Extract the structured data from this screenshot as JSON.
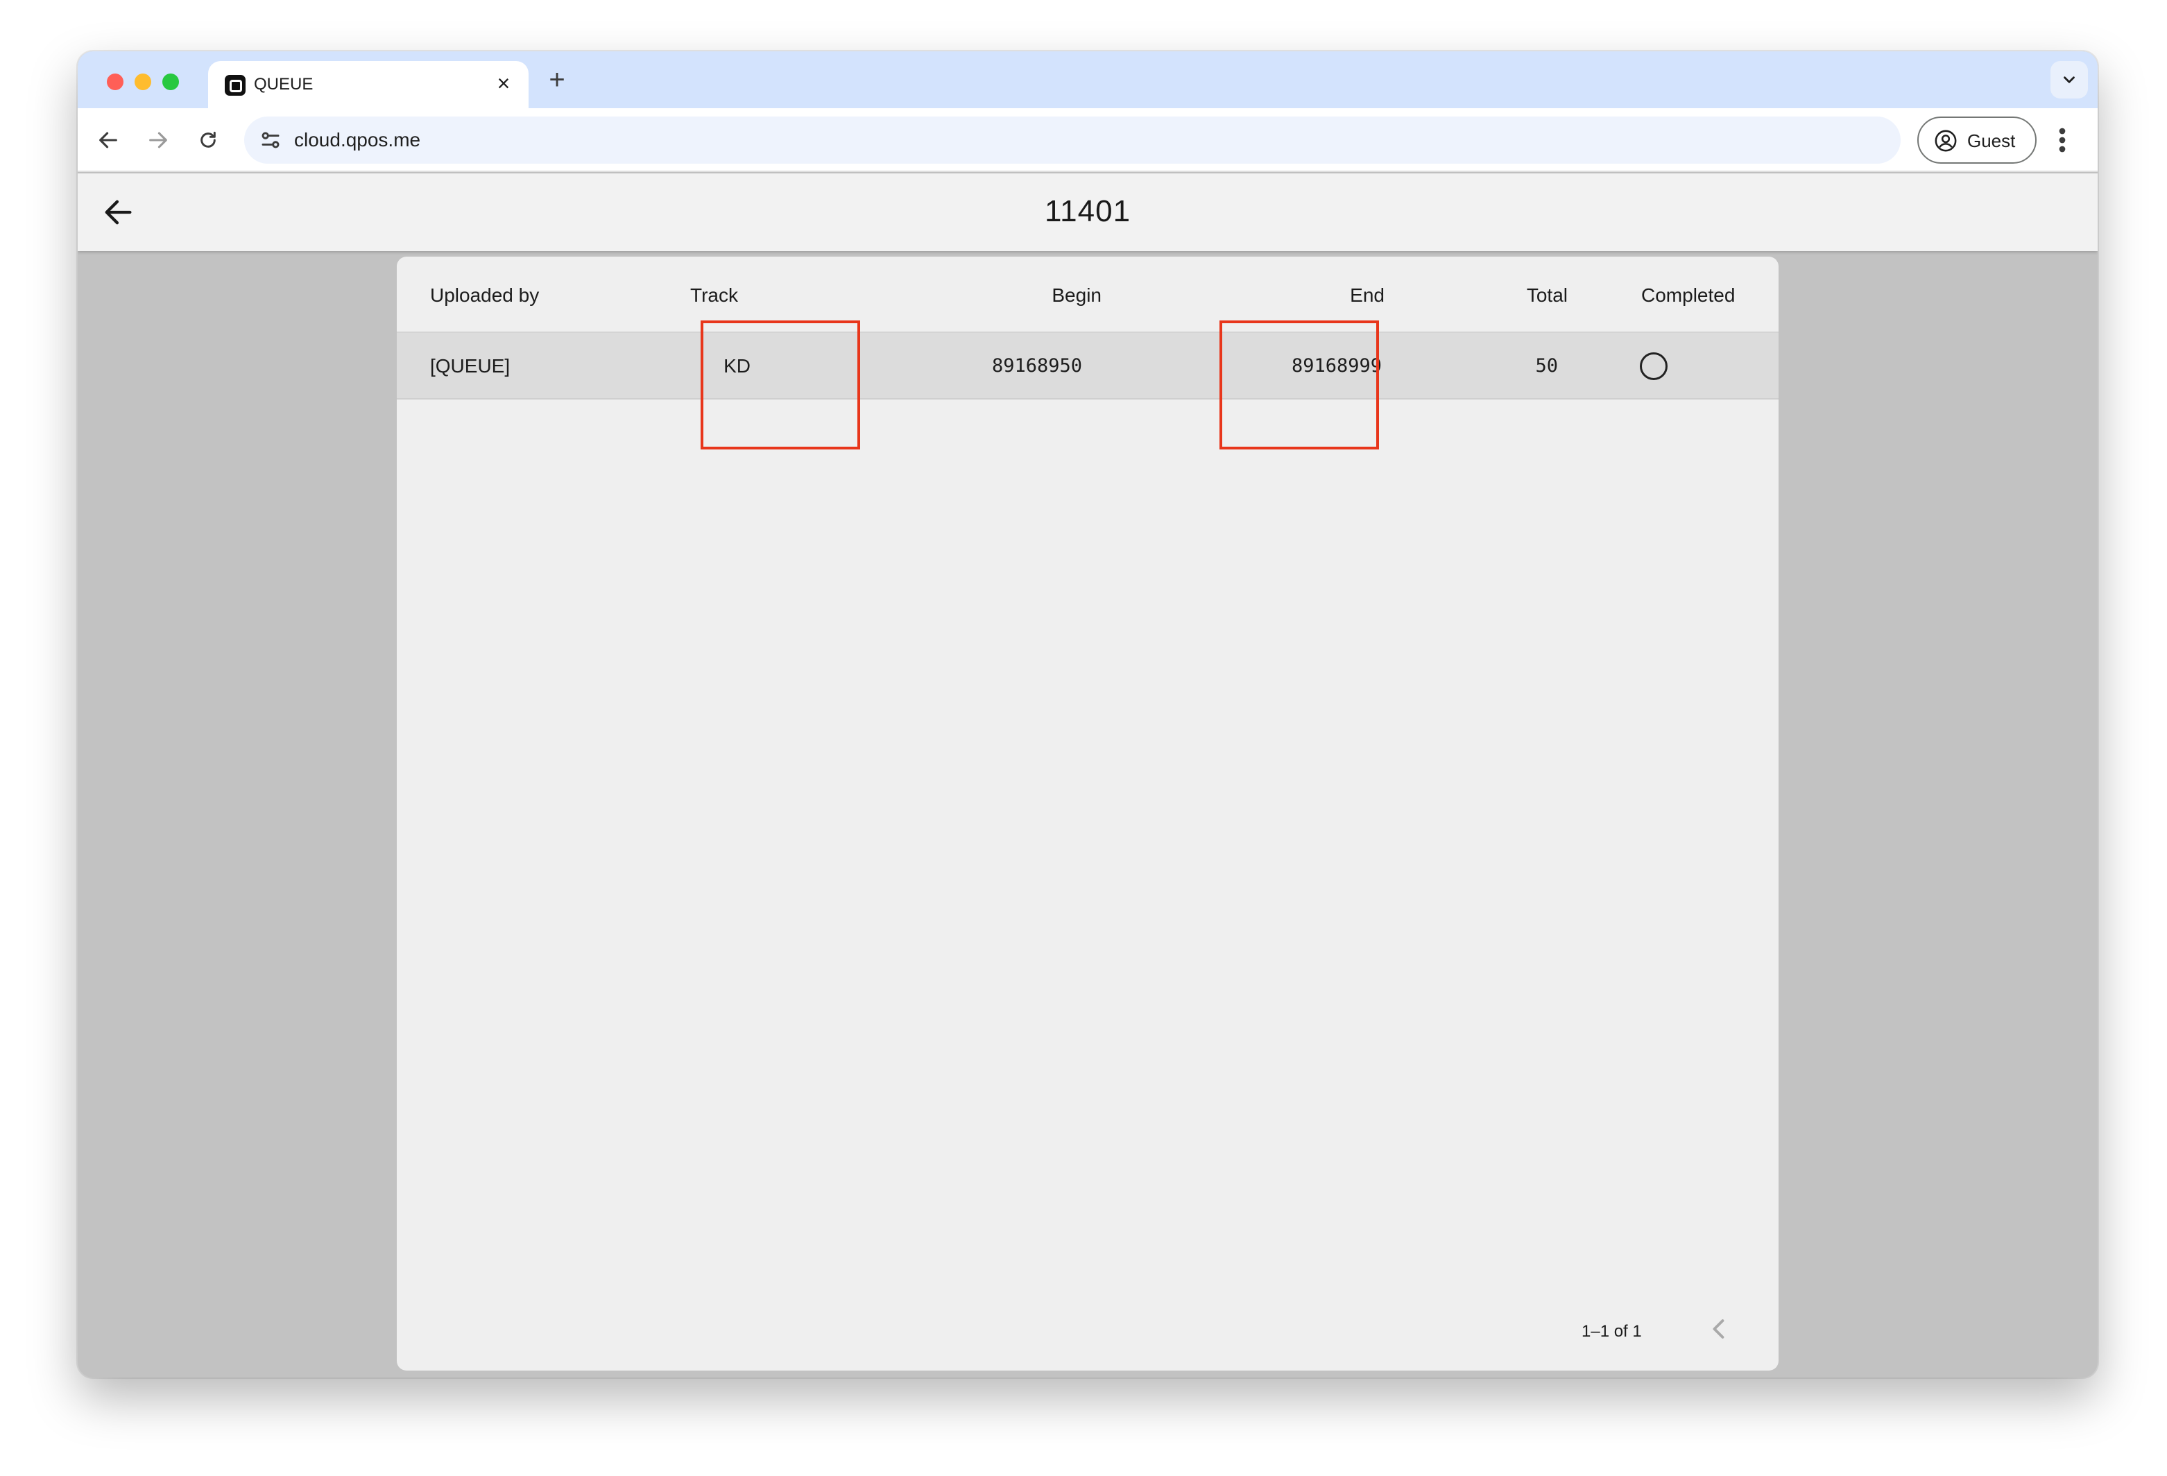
{
  "browser": {
    "tab_title": "QUEUE",
    "tab_close": "×",
    "new_tab": "+",
    "url": "cloud.qpos.me",
    "profile_label": "Guest"
  },
  "app": {
    "title": "11401"
  },
  "table": {
    "columns": {
      "uploaded_by": "Uploaded by",
      "track": "Track",
      "begin": "Begin",
      "end": "End",
      "total": "Total",
      "completed": "Completed"
    },
    "rows": [
      {
        "uploaded_by": "[QUEUE]",
        "track": "KD",
        "begin": "89168950",
        "end": "89168999",
        "total": "50",
        "completed": false
      }
    ]
  },
  "pagination": {
    "range_text": "1–1 of 1"
  },
  "colors": {
    "highlight": "#e8361b",
    "tab_strip": "#d3e3fd"
  },
  "icons": {
    "back": "arrow-left-icon",
    "forward": "arrow-right-icon",
    "reload": "reload-icon",
    "site_settings": "tune-icon",
    "profile": "account-circle-icon",
    "menu": "more-vert-icon",
    "tab_search": "chevron-down-icon",
    "completed": "circle-outline-icon",
    "prev_page": "chevron-left-icon",
    "next_page": "chevron-right-icon"
  }
}
